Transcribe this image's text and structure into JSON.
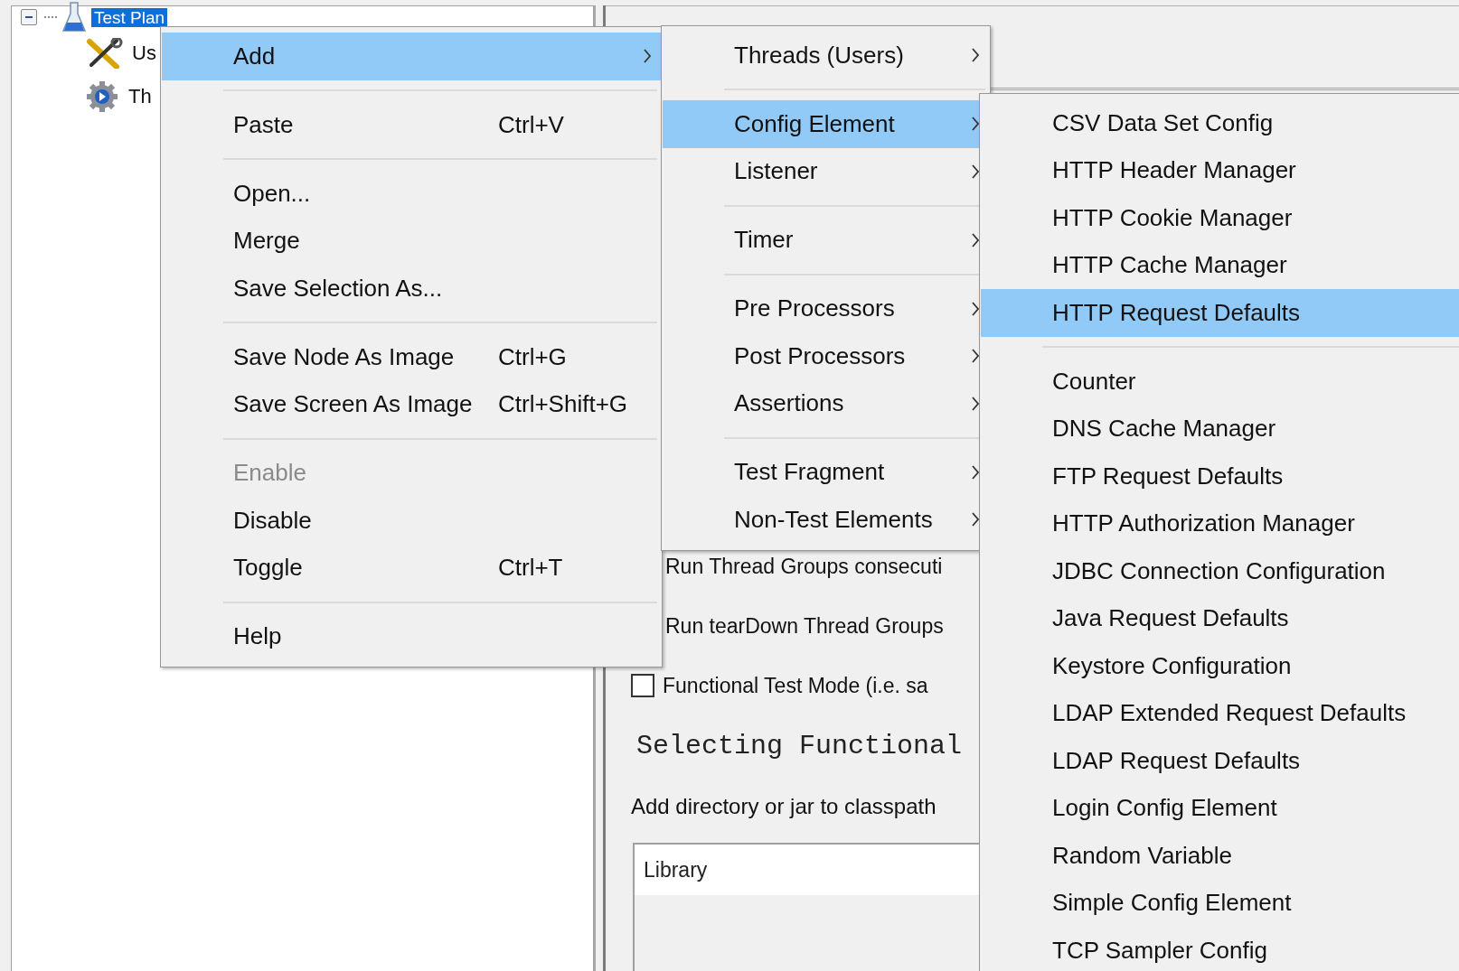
{
  "tree": {
    "label": "Test Plan",
    "selected": true,
    "expanded": true,
    "children": [
      {
        "label": "Us",
        "kind": "tools",
        "selected": false
      },
      {
        "label": "Th",
        "kind": "gear",
        "selected": false
      }
    ]
  },
  "panel": {
    "options": [
      {
        "kind": "text",
        "label": "Run Thread Groups consecuti"
      },
      {
        "kind": "text",
        "label": "Run tearDown Thread Groups"
      },
      {
        "kind": "checkbox",
        "label": "Functional Test Mode (i.e. sa",
        "checked": false
      }
    ],
    "note": "Selecting Functional",
    "classpath_label": "Add directory or jar to classpath",
    "table": {
      "columns": [
        "Library"
      ]
    }
  },
  "menus": [
    {
      "items": [
        {
          "kind": "item",
          "label": "Add",
          "submenu": true,
          "selected": true,
          "disabled": false
        },
        {
          "kind": "separator"
        },
        {
          "kind": "item",
          "label": "Paste",
          "shortcut": "Ctrl+V",
          "submenu": false,
          "selected": false,
          "disabled": false
        },
        {
          "kind": "separator"
        },
        {
          "kind": "item",
          "label": "Open...",
          "submenu": false,
          "selected": false,
          "disabled": false
        },
        {
          "kind": "item",
          "label": "Merge",
          "submenu": false,
          "selected": false,
          "disabled": false
        },
        {
          "kind": "item",
          "label": "Save Selection As...",
          "submenu": false,
          "selected": false,
          "disabled": false
        },
        {
          "kind": "separator"
        },
        {
          "kind": "item",
          "label": "Save Node As Image",
          "shortcut": "Ctrl+G",
          "submenu": false,
          "selected": false,
          "disabled": false
        },
        {
          "kind": "item",
          "label": "Save Screen As Image",
          "shortcut": "Ctrl+Shift+G",
          "submenu": false,
          "selected": false,
          "disabled": false
        },
        {
          "kind": "separator"
        },
        {
          "kind": "item",
          "label": "Enable",
          "submenu": false,
          "selected": false,
          "disabled": true
        },
        {
          "kind": "item",
          "label": "Disable",
          "submenu": false,
          "selected": false,
          "disabled": false
        },
        {
          "kind": "item",
          "label": "Toggle",
          "shortcut": "Ctrl+T",
          "submenu": false,
          "selected": false,
          "disabled": false
        },
        {
          "kind": "separator"
        },
        {
          "kind": "item",
          "label": "Help",
          "submenu": false,
          "selected": false,
          "disabled": false
        }
      ]
    },
    {
      "items": [
        {
          "kind": "item",
          "label": "Threads (Users)",
          "submenu": true,
          "selected": false,
          "disabled": false
        },
        {
          "kind": "separator"
        },
        {
          "kind": "item",
          "label": "Config Element",
          "submenu": true,
          "selected": true,
          "disabled": false
        },
        {
          "kind": "item",
          "label": "Listener",
          "submenu": true,
          "selected": false,
          "disabled": false
        },
        {
          "kind": "separator"
        },
        {
          "kind": "item",
          "label": "Timer",
          "submenu": true,
          "selected": false,
          "disabled": false
        },
        {
          "kind": "separator"
        },
        {
          "kind": "item",
          "label": "Pre Processors",
          "submenu": true,
          "selected": false,
          "disabled": false
        },
        {
          "kind": "item",
          "label": "Post Processors",
          "submenu": true,
          "selected": false,
          "disabled": false
        },
        {
          "kind": "item",
          "label": "Assertions",
          "submenu": true,
          "selected": false,
          "disabled": false
        },
        {
          "kind": "separator"
        },
        {
          "kind": "item",
          "label": "Test Fragment",
          "submenu": true,
          "selected": false,
          "disabled": false
        },
        {
          "kind": "item",
          "label": "Non-Test Elements",
          "submenu": true,
          "selected": false,
          "disabled": false
        }
      ]
    },
    {
      "items": [
        {
          "kind": "item",
          "label": "CSV Data Set Config",
          "selected": false
        },
        {
          "kind": "item",
          "label": "HTTP Header Manager",
          "selected": false
        },
        {
          "kind": "item",
          "label": "HTTP Cookie Manager",
          "selected": false
        },
        {
          "kind": "item",
          "label": "HTTP Cache Manager",
          "selected": false
        },
        {
          "kind": "item",
          "label": "HTTP Request Defaults",
          "selected": true
        },
        {
          "kind": "separator"
        },
        {
          "kind": "item",
          "label": "Counter",
          "selected": false
        },
        {
          "kind": "item",
          "label": "DNS Cache Manager",
          "selected": false
        },
        {
          "kind": "item",
          "label": "FTP Request Defaults",
          "selected": false
        },
        {
          "kind": "item",
          "label": "HTTP Authorization Manager",
          "selected": false
        },
        {
          "kind": "item",
          "label": "JDBC Connection Configuration",
          "selected": false
        },
        {
          "kind": "item",
          "label": "Java Request Defaults",
          "selected": false
        },
        {
          "kind": "item",
          "label": "Keystore Configuration",
          "selected": false
        },
        {
          "kind": "item",
          "label": "LDAP Extended Request Defaults",
          "selected": false
        },
        {
          "kind": "item",
          "label": "LDAP Request Defaults",
          "selected": false
        },
        {
          "kind": "item",
          "label": "Login Config Element",
          "selected": false
        },
        {
          "kind": "item",
          "label": "Random Variable",
          "selected": false
        },
        {
          "kind": "item",
          "label": "Simple Config Element",
          "selected": false
        },
        {
          "kind": "item",
          "label": "TCP Sampler Config",
          "selected": false
        }
      ]
    }
  ]
}
